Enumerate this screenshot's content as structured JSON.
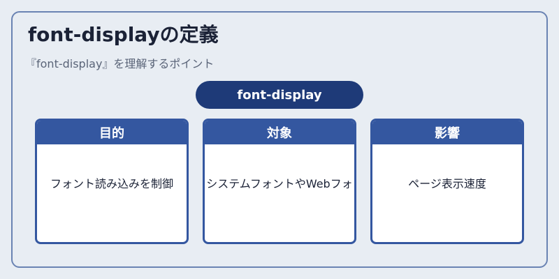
{
  "header": {
    "title": "font-displayの定義",
    "subtitle": "『font-display』を理解するポイント"
  },
  "center": {
    "label": "font-display"
  },
  "cards": [
    {
      "title": "目的",
      "body": "フォント読み込みを制御"
    },
    {
      "title": "対象",
      "body": "システムフォントやWebフォ"
    },
    {
      "title": "影響",
      "body": "ページ表示速度"
    }
  ],
  "colors": {
    "background": "#e8edf3",
    "frame_border": "#6a83b3",
    "pill": "#1e3a78",
    "card_accent": "#3457a0"
  }
}
